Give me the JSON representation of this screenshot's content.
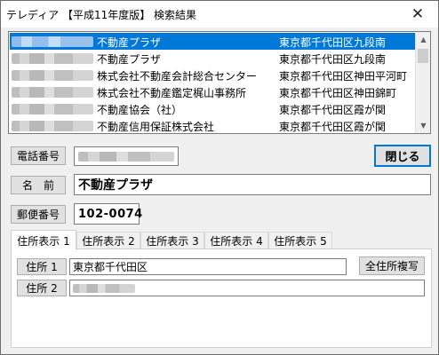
{
  "window": {
    "title": "テレディア 【平成11年度版】 検索結果",
    "close_glyph": "✕"
  },
  "results": {
    "selected_index": 0,
    "rows": [
      {
        "name": "不動産プラザ",
        "address": "東京都千代田区九段南"
      },
      {
        "name": "不動産プラザ",
        "address": "東京都千代田区九段南"
      },
      {
        "name": "株式会社不動産会計総合センター",
        "address": "東京都千代田区神田平河町"
      },
      {
        "name": "株式会社不動産鑑定梶山事務所",
        "address": "東京都千代田区神田錦町"
      },
      {
        "name": "不動産協会（社）",
        "address": "東京都千代田区霞が関"
      },
      {
        "name": "不動産信用保証株式会社",
        "address": "東京都千代田区霞が関"
      }
    ],
    "scroll_up_icon": "▲",
    "scroll_down_icon": "▼"
  },
  "detail": {
    "phone_label": "電話番号",
    "name_label": "名　前",
    "zip_label": "郵便番号",
    "name_value": "不動産プラザ",
    "zip_value": "102-0074",
    "close_label": "閉じる"
  },
  "tabs": [
    "住所表示 1",
    "住所表示 2",
    "住所表示 3",
    "住所表示 4",
    "住所表示 5"
  ],
  "active_tab": 0,
  "address": {
    "addr1_label": "住所 1",
    "addr2_label": "住所 2",
    "addr1_value": "東京都千代田区",
    "copy_all_label": "全住所複写"
  }
}
